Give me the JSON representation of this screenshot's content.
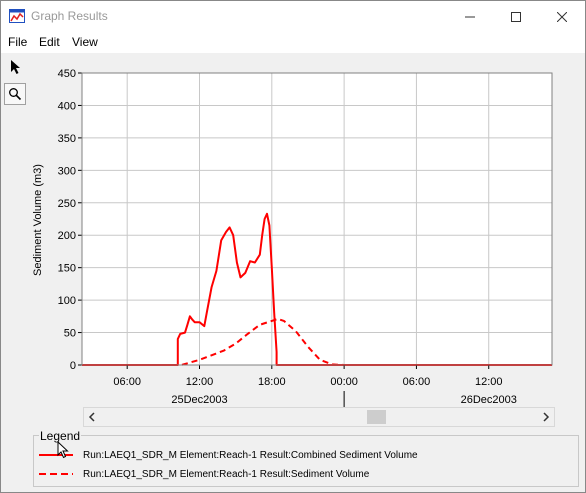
{
  "window": {
    "title": "Graph Results",
    "icon": "chart-window-icon",
    "controls": [
      "minimize-icon",
      "maximize-icon",
      "close-icon"
    ]
  },
  "menu": {
    "file": "File",
    "edit": "Edit",
    "view": "View"
  },
  "toolbar": {
    "tools": [
      "pointer-arrow-icon",
      "zoom-magnifier-icon"
    ]
  },
  "legend": {
    "title": "Legend",
    "items": [
      {
        "label": "Run:LAEQ1_SDR_M Element:Reach-1 Result:Combined Sediment Volume",
        "style": "solid",
        "color": "#ff0000"
      },
      {
        "label": "Run:LAEQ1_SDR_M Element:Reach-1 Result:Sediment Volume",
        "style": "dashed",
        "color": "#ff0000"
      }
    ]
  },
  "colors": {
    "series": "#ff0000",
    "grid": "#c8c8c8",
    "plot_background": "#ffffff",
    "window_background": "#f0f0f0"
  },
  "chart_data": {
    "type": "line",
    "ylabel": "Sediment Volume (m3)",
    "xlabel": "",
    "ylim": [
      0,
      450
    ],
    "yticks": [
      "0",
      "50",
      "100",
      "150",
      "200",
      "250",
      "300",
      "350",
      "400",
      "450"
    ],
    "xlim": [
      -21.75,
      17.25
    ],
    "x_units": "hours relative to 00:00 26Dec2003",
    "xticks": [
      {
        "x": -18,
        "label": "06:00"
      },
      {
        "x": -12,
        "label": "12:00"
      },
      {
        "x": -6,
        "label": "18:00"
      },
      {
        "x": 0,
        "label": "00:00"
      },
      {
        "x": 6,
        "label": "06:00"
      },
      {
        "x": 12,
        "label": "12:00"
      }
    ],
    "date_labels": [
      {
        "x": -12,
        "label": "25Dec2003"
      },
      {
        "x": 12,
        "label": "26Dec2003"
      }
    ],
    "day_divider_x": 0,
    "grid": true,
    "legend_position": "bottom",
    "series": [
      {
        "name": "Run:LAEQ1_SDR_M Element:Reach-1 Result:Combined Sediment Volume",
        "style": "solid",
        "points": [
          [
            -21.75,
            0
          ],
          [
            -14.0,
            0
          ],
          [
            -13.8,
            0
          ],
          [
            -13.8,
            40
          ],
          [
            -13.6,
            48
          ],
          [
            -13.2,
            50
          ],
          [
            -13.0,
            62
          ],
          [
            -12.8,
            75
          ],
          [
            -12.6,
            70
          ],
          [
            -12.4,
            66
          ],
          [
            -12.0,
            66
          ],
          [
            -11.6,
            60
          ],
          [
            -11.4,
            80
          ],
          [
            -11.0,
            120
          ],
          [
            -10.6,
            145
          ],
          [
            -10.2,
            192
          ],
          [
            -9.8,
            205
          ],
          [
            -9.5,
            212
          ],
          [
            -9.2,
            200
          ],
          [
            -8.9,
            158
          ],
          [
            -8.6,
            135
          ],
          [
            -8.2,
            142
          ],
          [
            -7.8,
            160
          ],
          [
            -7.4,
            158
          ],
          [
            -7.0,
            170
          ],
          [
            -6.8,
            200
          ],
          [
            -6.6,
            225
          ],
          [
            -6.4,
            233
          ],
          [
            -6.2,
            215
          ],
          [
            -6.0,
            150
          ],
          [
            -5.8,
            80
          ],
          [
            -5.6,
            20
          ],
          [
            -5.6,
            0
          ],
          [
            17.25,
            0
          ]
        ]
      },
      {
        "name": "Run:LAEQ1_SDR_M Element:Reach-1 Result:Sediment Volume",
        "style": "dashed",
        "points": [
          [
            -21.75,
            0
          ],
          [
            -13.5,
            0
          ],
          [
            -12.0,
            8
          ],
          [
            -10.0,
            22
          ],
          [
            -9.0,
            33
          ],
          [
            -8.0,
            48
          ],
          [
            -7.0,
            62
          ],
          [
            -6.0,
            68
          ],
          [
            -5.5,
            71
          ],
          [
            -5.0,
            68
          ],
          [
            -4.0,
            52
          ],
          [
            -3.0,
            28
          ],
          [
            -2.0,
            8
          ],
          [
            -1.0,
            1
          ],
          [
            0,
            0
          ],
          [
            17.25,
            0
          ]
        ]
      }
    ]
  }
}
